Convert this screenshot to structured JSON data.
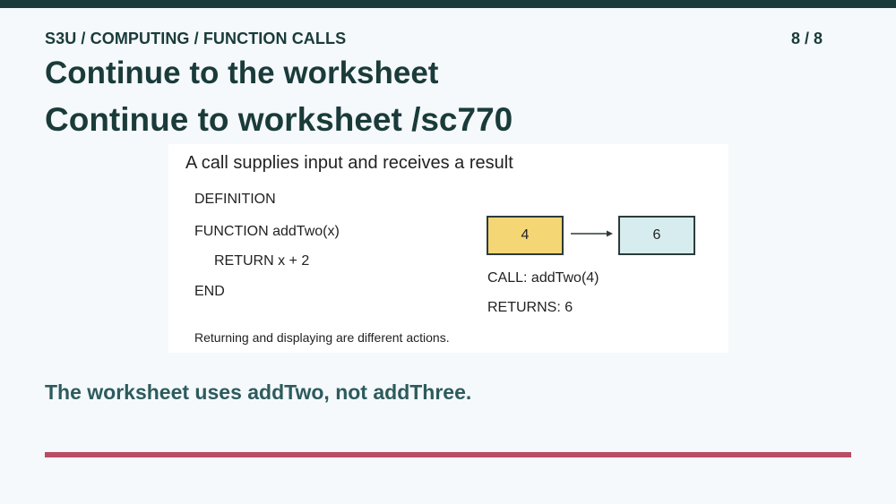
{
  "header": {
    "breadcrumb": "S3U / COMPUTING / FUNCTION CALLS",
    "page_indicator": "8 / 8"
  },
  "headings": {
    "primary": "Continue to the worksheet",
    "secondary": "Continue to worksheet /sc770"
  },
  "panel": {
    "title": "A call supplies input and receives a result",
    "code": {
      "label": "DEFINITION",
      "lines": [
        "FUNCTION addTwo(x)",
        "RETURN x + 2",
        "END"
      ]
    },
    "diagram": {
      "input_value": "4",
      "output_value": "6",
      "call_text": "CALL: addTwo(4)",
      "returns_text": "RETURNS: 6"
    },
    "footnote": "Returning and displaying are different actions."
  },
  "takeaway": "The worksheet uses addTwo, not addThree.",
  "colors": {
    "top_bar": "#1a3b3a",
    "heading": "#1a3b3a",
    "takeaway": "#2d5b5d",
    "input_box": "#f4d675",
    "output_box": "#d7ecee",
    "rule": "#b84d64",
    "background": "#f5f9fc"
  }
}
